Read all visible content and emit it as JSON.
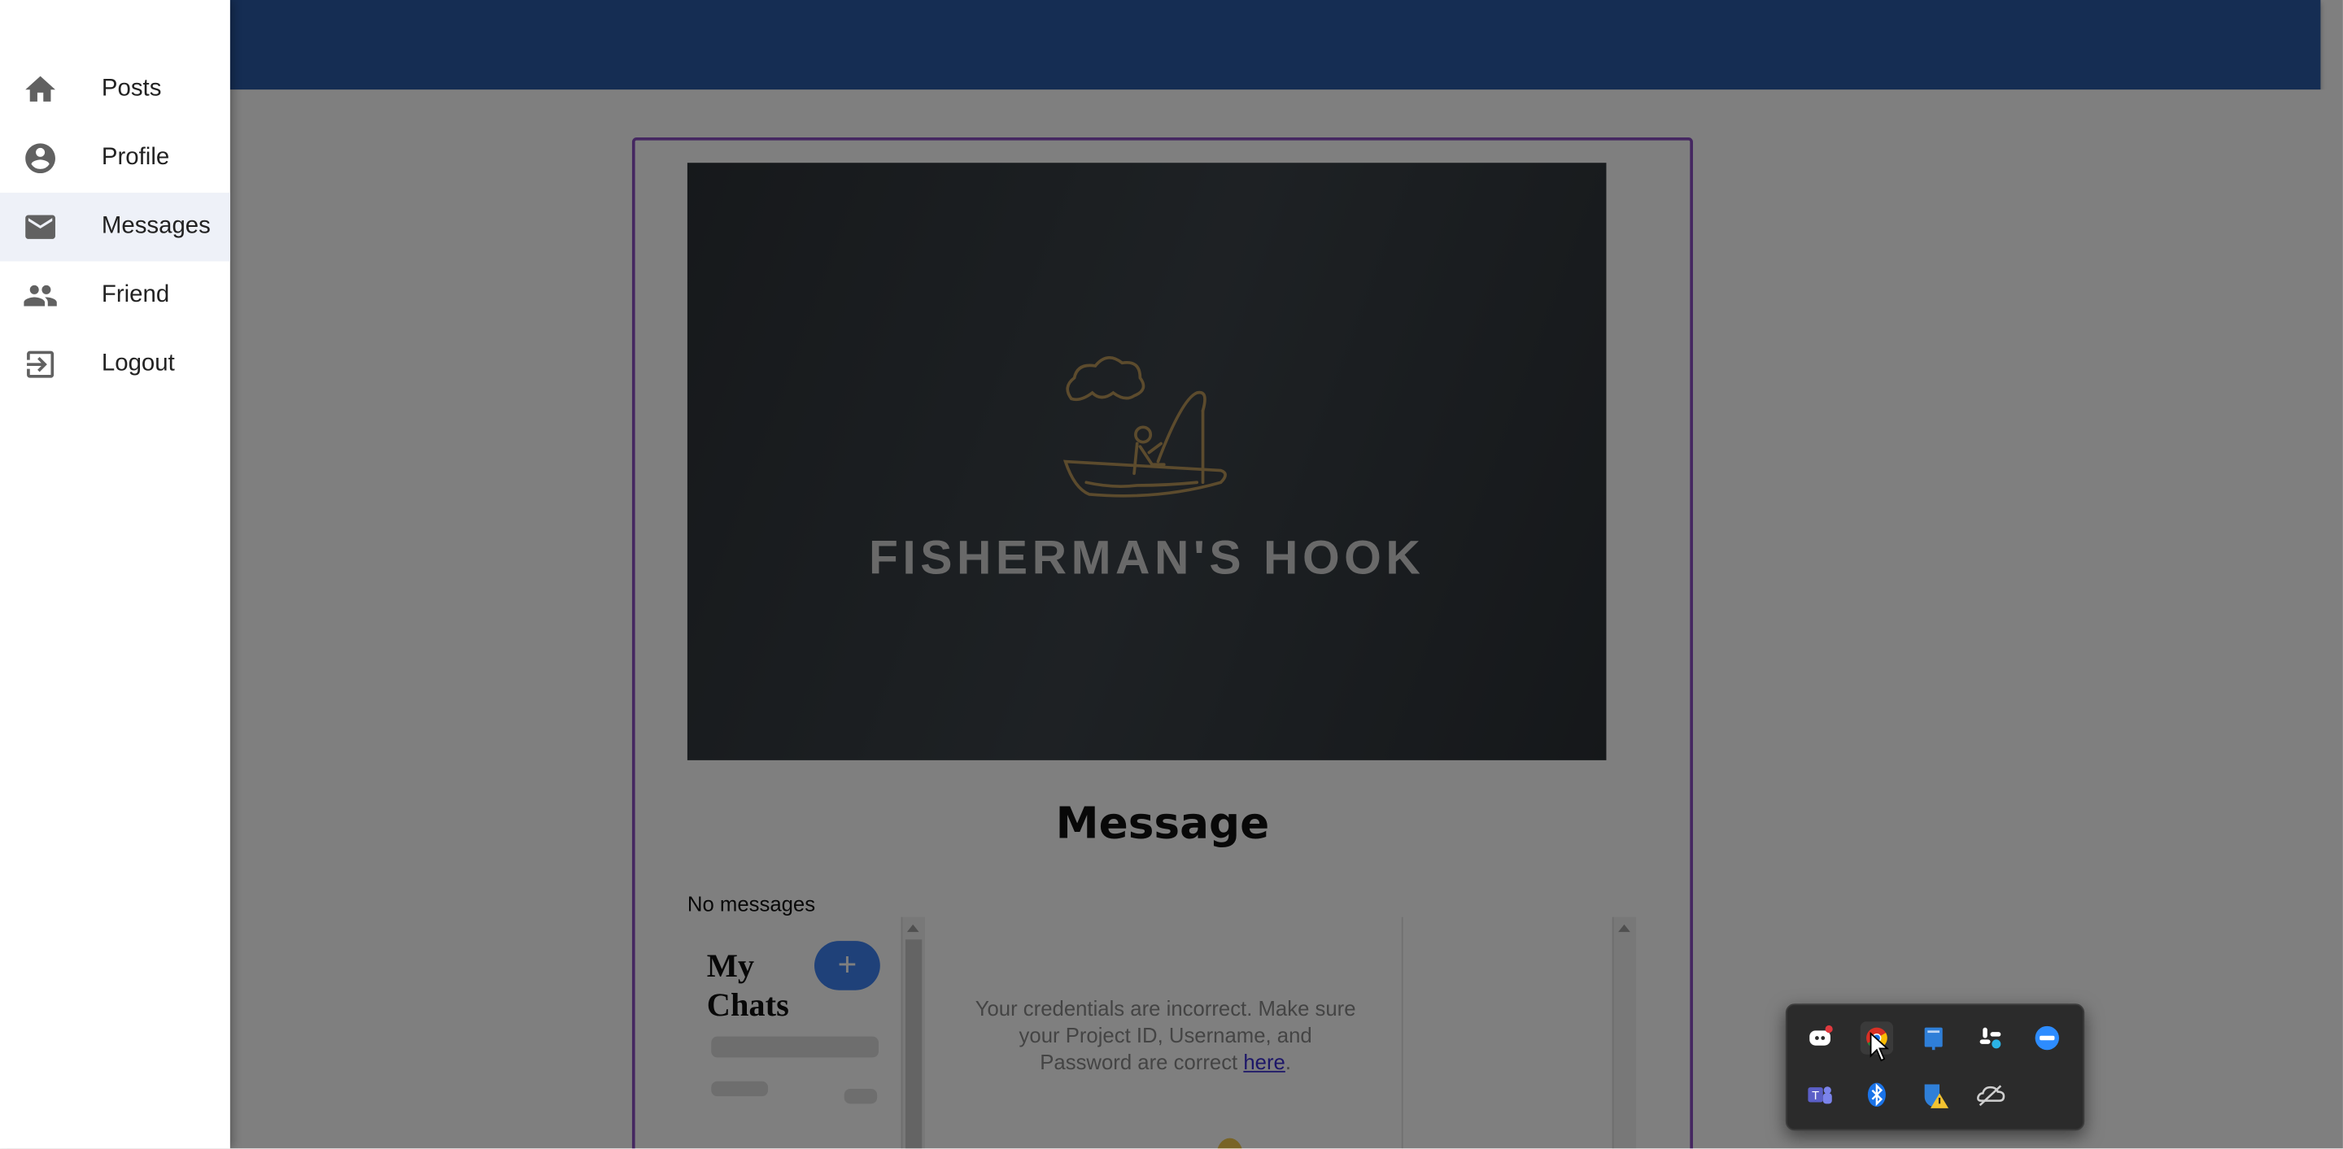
{
  "nav": {
    "items": [
      {
        "label": "Posts",
        "icon": "home-icon"
      },
      {
        "label": "Profile",
        "icon": "account-circle-icon"
      },
      {
        "label": "Messages",
        "icon": "mail-icon",
        "active": true
      },
      {
        "label": "Friend",
        "icon": "people-icon"
      },
      {
        "label": "Logout",
        "icon": "logout-icon"
      }
    ]
  },
  "banner": {
    "brand": "FISHERMAN'S HOOK",
    "logo": "fisherman-boat-logo"
  },
  "message": {
    "title": "Message",
    "empty_text": "No messages",
    "chat_list_title": "My Chats",
    "add_label": "+",
    "credentials_error": "Your credentials are incorrect. Make sure your Project ID, Username, and Password are correct",
    "credentials_link": "here",
    "credentials_suffix": "."
  },
  "tray": {
    "icons": [
      "discord-icon",
      "chrome-icon",
      "teams-blue-icon",
      "slack-icon",
      "zoom-icon",
      "teams-icon",
      "bluetooth-icon",
      "security-warning-icon",
      "onedrive-icon"
    ]
  },
  "colors": {
    "topbar": "#2a5ba7",
    "accent": "#3f82f2",
    "card_border": "#8a4fc3",
    "overlay": "rgba(0,0,0,0.5)"
  }
}
